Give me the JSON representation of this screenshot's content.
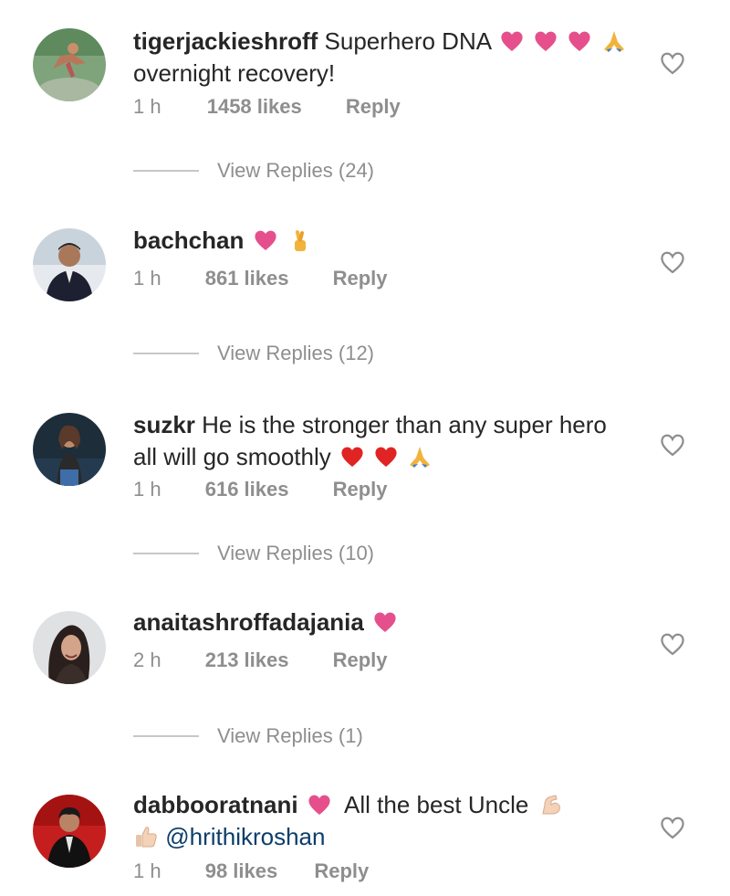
{
  "comments": [
    {
      "username": "tigerjackieshroff",
      "text_line1": "Superhero DNA",
      "text_line2": "overnight recovery!",
      "time": "1 h",
      "likes": "1458 likes",
      "reply": "Reply",
      "view_replies": "View Replies (24)",
      "emojis": [
        "pink-heart",
        "pink-heart",
        "pink-heart",
        "folded-hands"
      ]
    },
    {
      "username": "bachchan",
      "text_line1": "",
      "time": "1 h",
      "likes": "861 likes",
      "reply": "Reply",
      "view_replies": "View Replies (12)",
      "emojis": [
        "pink-heart",
        "crossed-fingers"
      ]
    },
    {
      "username": "suzkr",
      "text_line1": "He is the stronger than any super hero",
      "text_line2": "all will go smoothly",
      "time": "1 h",
      "likes": "616 likes",
      "reply": "Reply",
      "view_replies": "View Replies (10)",
      "emojis": [
        "red-heart",
        "red-heart",
        "folded-hands"
      ]
    },
    {
      "username": "anaitashroffadajania",
      "text_line1": "",
      "time": "2 h",
      "likes": "213 likes",
      "reply": "Reply",
      "view_replies": "View Replies (1)",
      "emojis": [
        "pink-heart"
      ]
    },
    {
      "username": "dabbooratnani",
      "text_line1": "All the best Uncle",
      "text_line2_mention": "@hrithikroshan",
      "time": "1 h",
      "likes": "98 likes",
      "reply": "Reply",
      "emojis": [
        "pink-heart",
        "flexed-biceps",
        "thumbs-up"
      ]
    }
  ],
  "colors": {
    "text": "#262626",
    "meta": "#8e8e8e",
    "pink_heart": "#e5508c",
    "red_heart": "#e02424",
    "mention": "#0b3d6b"
  }
}
